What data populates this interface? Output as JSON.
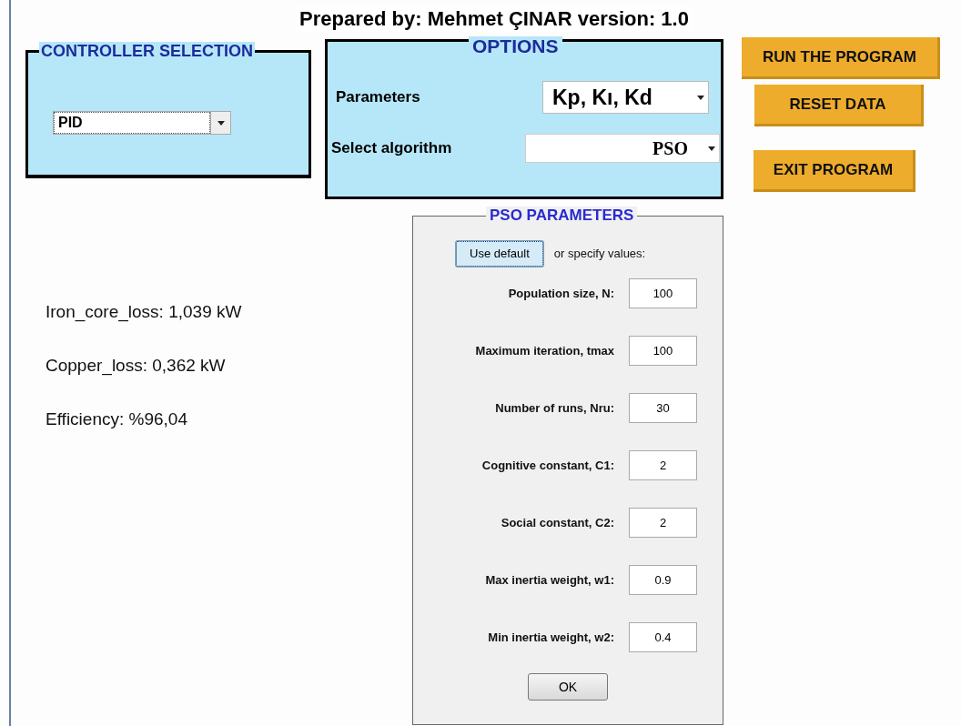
{
  "header": {
    "text": "Prepared by: Mehmet ÇINAR version: 1.0"
  },
  "controller_selection": {
    "title": "CONTROLLER SELECTION",
    "dropdown": {
      "value": "PID"
    }
  },
  "options": {
    "title": "OPTIONS",
    "fields": [
      {
        "label": "Parameters",
        "value": "Kp, Kı, Kd"
      },
      {
        "label": "Select algorithm",
        "value": "PSO"
      }
    ]
  },
  "buttons": [
    "RUN THE PROGRAM",
    "RESET DATA",
    "EXIT PROGRAM"
  ],
  "results": [
    "Iron_core_loss: 1,039 kW",
    "Copper_loss: 0,362 kW",
    "Efficiency: %96,04"
  ],
  "pso_parameters": {
    "title": "PSO PARAMETERS",
    "default_button": "Use default",
    "hint": "or specify values:",
    "fields": [
      {
        "label": "Population size, N:",
        "value": "100"
      },
      {
        "label": "Maximum iteration, tmax",
        "value": "100"
      },
      {
        "label": "Number of runs, Nru:",
        "value": "30"
      },
      {
        "label": "Cognitive constant, C1:",
        "value": "2"
      },
      {
        "label": "Social constant, C2:",
        "value": "2"
      },
      {
        "label": "Max inertia weight, w1:",
        "value": "0.9"
      },
      {
        "label": "Min inertia weight, w2:",
        "value": "0.4"
      }
    ],
    "ok_button": "OK"
  }
}
